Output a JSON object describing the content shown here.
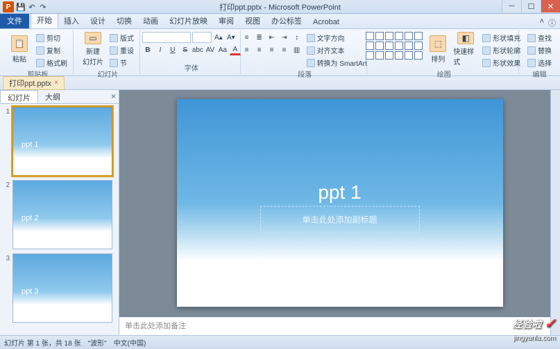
{
  "window": {
    "title": "打印ppt.pptx - Microsoft PowerPoint",
    "min": "─",
    "max": "☐",
    "close": "✕"
  },
  "qat": {
    "save": "💾",
    "undo": "↶",
    "redo": "↷"
  },
  "tabs": {
    "file": "文件",
    "items": [
      "开始",
      "插入",
      "设计",
      "切换",
      "动画",
      "幻灯片放映",
      "审阅",
      "视图",
      "办公标签",
      "Acrobat"
    ],
    "active_index": 0,
    "help": "ⓘ",
    "min_ribbon": "˄"
  },
  "ribbon": {
    "clipboard": {
      "label": "剪贴板",
      "paste": "粘贴",
      "cut": "剪切",
      "copy": "复制",
      "format_painter": "格式刷"
    },
    "slides": {
      "label": "幻灯片",
      "new_slide": "新建\n幻灯片",
      "layout": "版式",
      "reset": "重设",
      "section": "节"
    },
    "font": {
      "label": "字体",
      "bold": "B",
      "italic": "I",
      "underline": "U",
      "strike": "S",
      "shadow": "abc",
      "spacing": "AV",
      "case": "Aa",
      "grow": "A▴",
      "shrink": "A▾",
      "clear": "A⌫",
      "color": "A"
    },
    "paragraph": {
      "label": "段落",
      "text_direction": "文字方向",
      "align_text": "对齐文本",
      "convert_smartart": "转换为 SmartArt"
    },
    "drawing": {
      "label": "绘图",
      "arrange": "排列",
      "quick_styles": "快速样式",
      "shape_fill": "形状填充",
      "shape_outline": "形状轮廓",
      "shape_effects": "形状效果"
    },
    "editing": {
      "label": "编辑",
      "find": "查找",
      "replace": "替换",
      "select": "选择"
    }
  },
  "doc_tab": {
    "name": "打印ppt.pptx",
    "close": "×"
  },
  "side": {
    "tab_slides": "幻灯片",
    "tab_outline": "大纲",
    "close": "×",
    "thumbs": [
      {
        "num": "1",
        "label": "ppt 1"
      },
      {
        "num": "2",
        "label": "ppt 2"
      },
      {
        "num": "3",
        "label": "ppt 3"
      }
    ]
  },
  "slide": {
    "title": "ppt 1",
    "subtitle": "单击此处添加副标题"
  },
  "notes": {
    "placeholder": "单击此处添加备注"
  },
  "status": {
    "slide_info": "幻灯片 第 1 张，共 18 张",
    "theme": "\"波形\"",
    "lang": "中文(中国)"
  },
  "watermark": {
    "text": "经验啦",
    "url": "jingyanla.com",
    "check": "✓"
  }
}
